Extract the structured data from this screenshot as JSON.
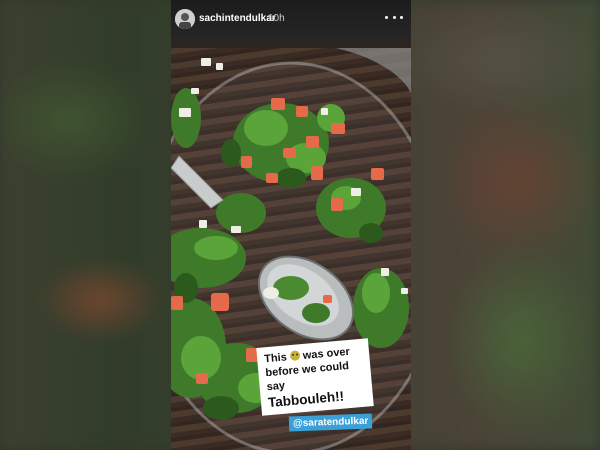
{
  "story": {
    "username": "sachintendulkar",
    "time": "10h",
    "more_icon": "more-horizontal-icon"
  },
  "caption": {
    "line1_before": "This",
    "emoji": "slightly-smiling-face",
    "line1_after": "was over",
    "line2": "before we could say",
    "line3": "Tabbouleh!!"
  },
  "mention": "@saratendulkar",
  "colors": {
    "mention_bg": "#3ba0d8",
    "topbar_bg": "#1c1c1c"
  }
}
